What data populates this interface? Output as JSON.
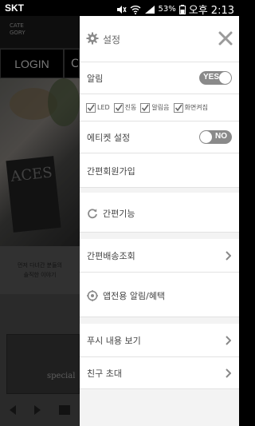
{
  "status_bar": {
    "carrier": "SKT",
    "battery": "53%",
    "time": "오후 2:13"
  },
  "background_app": {
    "category_label_line1": "CATE",
    "category_label_line2": "GORY",
    "login_label": "LOGIN",
    "second_button_partial": "C",
    "pack_text": "ACES",
    "caption_line1": "먼저 다녀간 분들의",
    "caption_line2": "솔직한 이야기",
    "special_label": "special"
  },
  "drawer": {
    "title": "설정",
    "alarm": {
      "label": "알림",
      "toggle_text": "YES"
    },
    "alarm_options": [
      {
        "label": "LED"
      },
      {
        "label": "진동"
      },
      {
        "label": "알림음"
      },
      {
        "label": "화면켜짐"
      }
    ],
    "etiquette": {
      "label": "에티켓 설정",
      "toggle_text": "NO"
    },
    "simple_signup": "간편회원가입",
    "simple_feature": "간편기능",
    "shipping_lookup": "간편배송조회",
    "app_notice": "앱전용 알림/혜택",
    "push_view": "푸시 내용 보기",
    "invite_friend": "친구 초대"
  },
  "colors": {
    "drawer_bg": "#f3f3f3",
    "row_bg": "#ffffff",
    "toggle_bg": "#8a8a8a",
    "icon_gray": "#9a9a9a"
  },
  "icons": {
    "header": "gear-icon",
    "close": "close-icon",
    "refresh": "refresh-icon",
    "target": "target-icon",
    "chevron": "chevron-right-icon",
    "checkbox": "checkbox-checked-icon"
  }
}
